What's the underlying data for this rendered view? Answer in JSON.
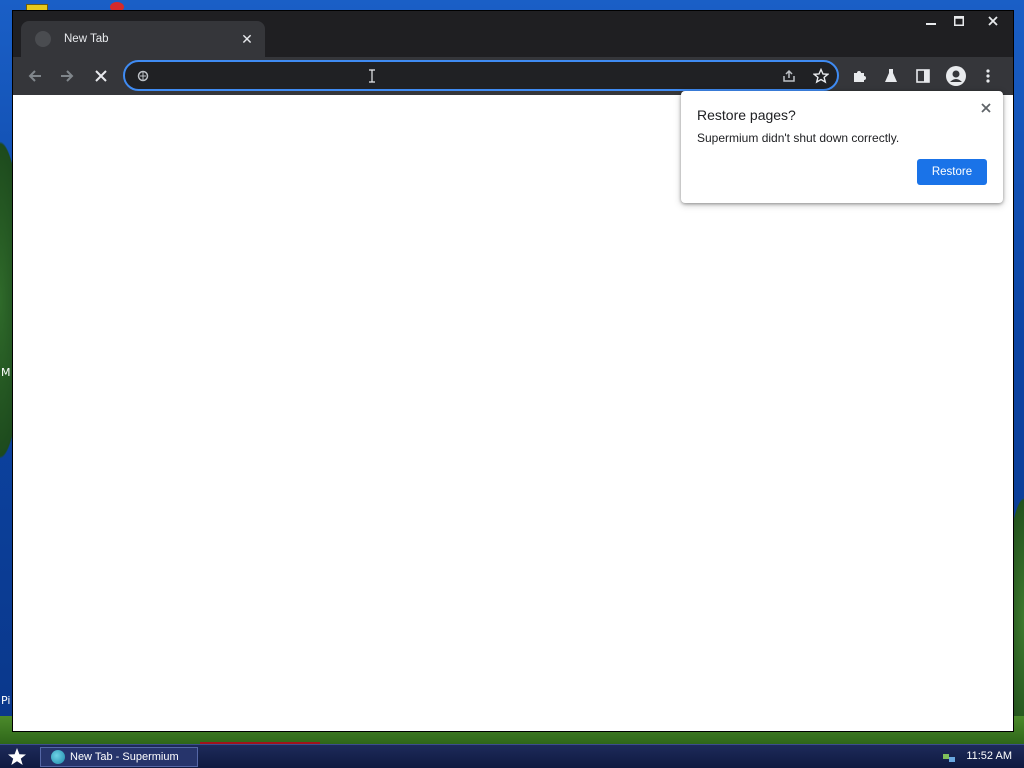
{
  "colors": {
    "accent": "#1a73e8",
    "omnibox_focus": "#3f8bf2",
    "toolbar_bg": "#35363a",
    "titlebar_bg": "#1f1f22"
  },
  "desktop": {
    "left_labels": [
      "M",
      "Pi"
    ]
  },
  "browser": {
    "tab": {
      "title": "New Tab",
      "favicon": "globe-icon",
      "close_glyph": "✕"
    },
    "window_controls": {
      "minimize": "minimize-icon",
      "maximize": "maximize-icon",
      "close": "close-icon"
    },
    "toolbar": {
      "back": "back-arrow-icon",
      "forward": "forward-arrow-icon",
      "stop": "stop-icon",
      "omnibox_value": "",
      "omnibox_placeholder": "",
      "icons": [
        "share-icon",
        "bookmark-star-icon",
        "extensions-icon",
        "labs-flask-icon",
        "side-panel-icon",
        "profile-icon",
        "menu-kebab-icon"
      ]
    },
    "popup": {
      "title": "Restore pages?",
      "message": "Supermium didn't shut down correctly.",
      "button_label": "Restore"
    }
  },
  "taskbar": {
    "window_label": "New Tab - Supermium",
    "clock": "11:52 AM"
  }
}
